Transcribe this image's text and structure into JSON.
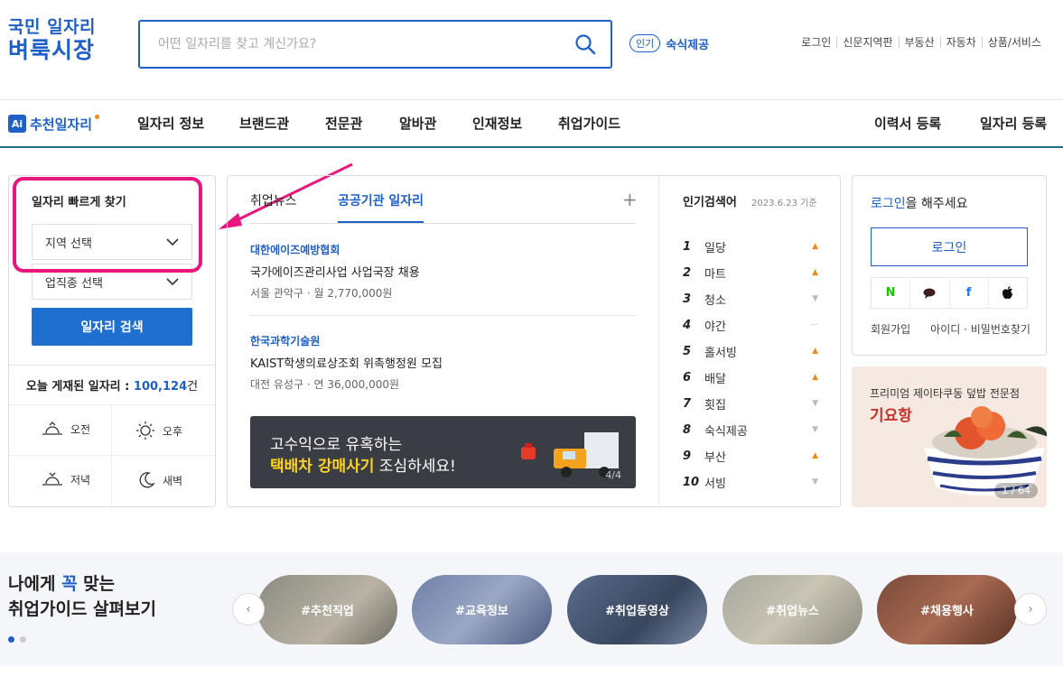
{
  "header": {
    "logo_line1": "국민 일자리",
    "logo_line2": "벼룩시장",
    "search_placeholder": "어떤 일자리를 찾고 계신가요?",
    "popular_badge": "인기",
    "popular_word": "숙식제공",
    "top_links": [
      "로그인",
      "신문지역판",
      "부동산",
      "자동차",
      "상품/서비스"
    ]
  },
  "nav": {
    "ai_badge": "Ai",
    "ai_label": "추천일자리",
    "items": [
      "일자리 정보",
      "브랜드관",
      "전문관",
      "알바관",
      "인재정보",
      "취업가이드"
    ],
    "right_items": [
      "이력서 등록",
      "일자리 등록"
    ]
  },
  "quick_search": {
    "title": "일자리 빠르게 찾기",
    "region_select": "지역 선택",
    "industry_select": "업직종 선택",
    "search_button": "일자리 검색",
    "today_label": "오늘 게재된 일자리 :",
    "today_count": "100,124",
    "today_unit": "건",
    "times": [
      "오전",
      "오후",
      "저녁",
      "새벽"
    ]
  },
  "news": {
    "tabs": [
      "취업뉴스",
      "공공기관 일자리"
    ],
    "active_tab": 1,
    "items": [
      {
        "org": "대한에이즈예방협회",
        "title": "국가에이즈관리사업 사업국장 채용",
        "meta": "서울 관악구 · 월 2,770,000원"
      },
      {
        "org": "한국과학기술원",
        "title": "KAIST학생의료상조회 위촉행정원 모집",
        "meta": "대전 유성구 · 연 36,000,000원"
      }
    ],
    "banner_line1": "고수익으로 유혹하는",
    "banner_line2_highlight": "택배차 강매사기",
    "banner_line2_rest": " 조심하세요!",
    "banner_page": "4/4"
  },
  "ranking": {
    "title": "인기검색어",
    "date": "2023.6.23 기준",
    "items": [
      {
        "rank": "1",
        "word": "일당",
        "trend": "up"
      },
      {
        "rank": "2",
        "word": "마트",
        "trend": "up"
      },
      {
        "rank": "3",
        "word": "청소",
        "trend": "down"
      },
      {
        "rank": "4",
        "word": "야간",
        "trend": "same"
      },
      {
        "rank": "5",
        "word": "홀서빙",
        "trend": "up"
      },
      {
        "rank": "6",
        "word": "배달",
        "trend": "up"
      },
      {
        "rank": "7",
        "word": "횟집",
        "trend": "down"
      },
      {
        "rank": "8",
        "word": "숙식제공",
        "trend": "down"
      },
      {
        "rank": "9",
        "word": "부산",
        "trend": "up"
      },
      {
        "rank": "10",
        "word": "서빙",
        "trend": "down"
      }
    ]
  },
  "login": {
    "msg_link": "로그인",
    "msg_rest": "을 해주세요",
    "button": "로그인",
    "social": [
      "N",
      "●",
      "f",
      ""
    ],
    "signup": "회원가입",
    "find": "아이디 · 비밀번호찾기"
  },
  "ad": {
    "subtitle": "프리미엄 제이타쿠동 덮밥 전문점",
    "name": "기요항",
    "page": "1 / 64"
  },
  "guide": {
    "title_pre": "나에게 ",
    "title_accent": "꼭",
    "title_post": " 맞는",
    "title_line2": "취업가이드 살펴보기",
    "cards": [
      "#추천직업",
      "#교육정보",
      "#취업동영상",
      "#취업뉴스",
      "#채용행사"
    ],
    "prev": "‹",
    "next": "›"
  },
  "colors": {
    "brand": "#1e5fc8",
    "highlight": "#e8167d",
    "trend_up": "#f08a1c"
  }
}
